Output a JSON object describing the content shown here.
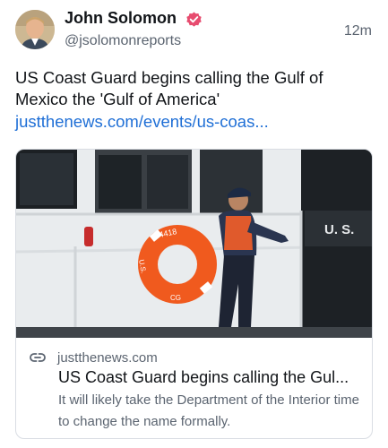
{
  "post": {
    "author": {
      "display_name": "John Solomon",
      "handle": "@jsolomonreports",
      "verified_icon": "verified-badge-icon",
      "verified_color": "#e74c6f"
    },
    "timestamp": "12m",
    "text": "US Coast Guard begins calling the Gulf of Mexico the 'Gulf of America'",
    "link_text": "justthenews.com/events/us-coas...",
    "link_color": "#1f6fd6"
  },
  "card": {
    "image_alt": "Coast Guard crew member on boat deck beside life ring",
    "image_text": {
      "hull_marking": "U. S.",
      "life_ring_number": "4418",
      "life_ring_left": "U.S.",
      "life_ring_bottom": "CG"
    },
    "domain_icon": "link-icon",
    "domain": "justthenews.com",
    "title": "US Coast Guard begins calling the Gul...",
    "description": "It will likely take the Department of the Interior time to change the name formally."
  }
}
